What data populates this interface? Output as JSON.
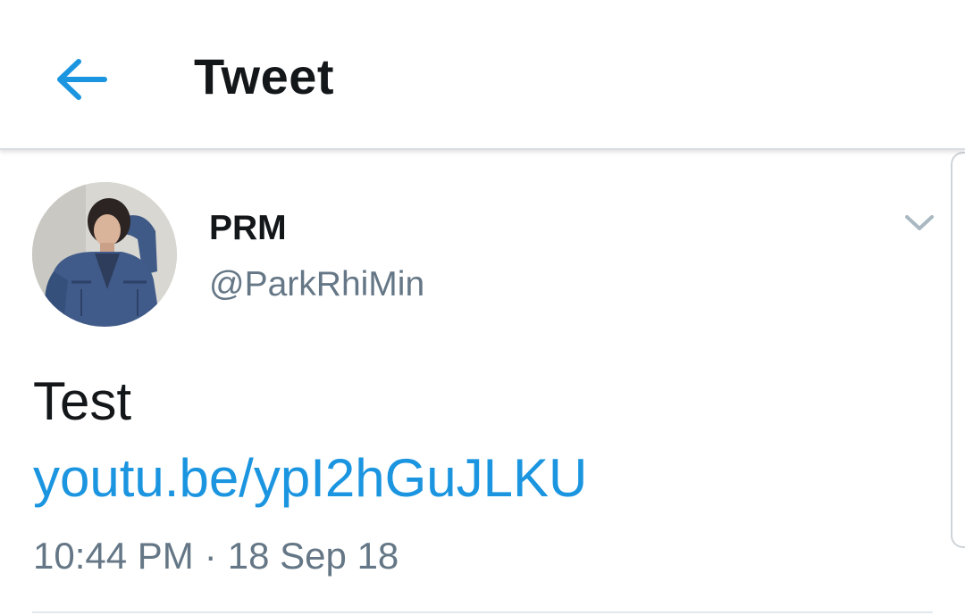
{
  "header": {
    "title": "Tweet",
    "back_icon": "arrow-left-icon"
  },
  "tweet": {
    "author": {
      "display_name": "PRM",
      "handle": "@ParkRhiMin",
      "avatar_icon": "profile-photo"
    },
    "text": "Test",
    "link": "youtu.be/ypI2hGuJLKU",
    "time": "10:44 PM",
    "separator": "·",
    "date": "18 Sep 18",
    "more_icon": "chevron-down-icon"
  },
  "colors": {
    "accent": "#1b95e0",
    "text_primary": "#14171a",
    "text_secondary": "#657786",
    "chevron": "#aab8c2",
    "divider": "#e1e8ed"
  }
}
